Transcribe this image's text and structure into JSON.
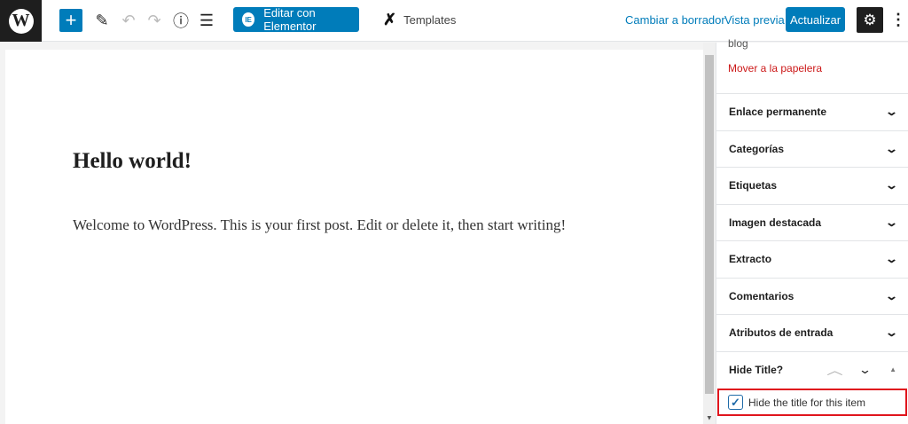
{
  "toolbar": {
    "wp_logo": "W",
    "add": "+",
    "edit_icon": "✎",
    "undo": "↶",
    "redo": "↷",
    "info": "ⓘ",
    "list": "☰",
    "elementor_label": "Editar con Elementor",
    "elementor_badge": "IE",
    "templates_label": "Templates",
    "templates_icon": "✗",
    "switch_draft": "Cambiar a borrador",
    "preview": "Vista previa",
    "update": "Actualizar",
    "settings": "⚙",
    "more": "⋮"
  },
  "post": {
    "title": "Hello world!",
    "content": "Welcome to WordPress. This is your first post. Edit or delete it, then start writing!"
  },
  "sidebar": {
    "blog": "blog",
    "trash": "Mover a la papelera",
    "panels": [
      {
        "label": "Enlace permanente"
      },
      {
        "label": "Categorías"
      },
      {
        "label": "Etiquetas"
      },
      {
        "label": "Imagen destacada"
      },
      {
        "label": "Extracto"
      },
      {
        "label": "Comentarios"
      },
      {
        "label": "Atributos de entrada"
      }
    ],
    "hide_title": {
      "label": "Hide Title?",
      "checkbox_label": "Hide the title for this item",
      "checked": true
    }
  },
  "icons": {
    "chevron_down": "⌄",
    "chevron_up": "︿",
    "triangle_up": "▲",
    "check": "✓"
  }
}
